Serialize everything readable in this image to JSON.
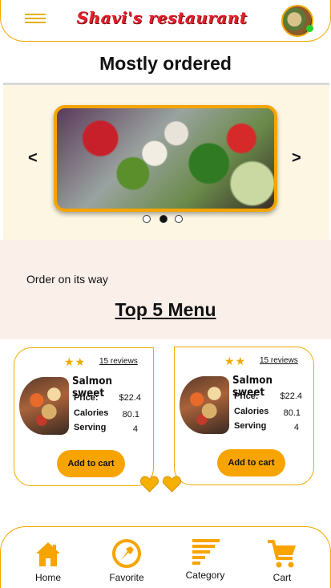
{
  "header": {
    "app_title": "Shavi's restaurant",
    "menu_icon": "hamburger-menu-icon",
    "avatar_icon": "profile-avatar",
    "status_color": "#23d12e"
  },
  "featured": {
    "title": "Mostly ordered",
    "prev_label": "<",
    "next_label": ">",
    "slide_count": 3,
    "active_slide": 2
  },
  "order_status": "Order on its way",
  "menu_section": {
    "heading": "Top 5 Menu",
    "cards": [
      {
        "stars": "★★",
        "reviews": "15 reviews",
        "name": "Salmon sweet",
        "price_label": "Price:",
        "price": "$22.4",
        "calories_label": "Calories",
        "calories": "80.1",
        "serving_label": "Serving",
        "serving": "4",
        "button": "Add to cart"
      },
      {
        "stars": "★★",
        "reviews": "15 reviews",
        "name": "Salmon sweet",
        "price_label": "Price:",
        "price": "$22.4",
        "calories_label": "Calories",
        "calories": "80.1",
        "serving_label": "Serving",
        "serving": "4",
        "button": "Add to cart"
      }
    ]
  },
  "bottom_nav": {
    "items": [
      {
        "label": "Home",
        "icon": "home-icon"
      },
      {
        "label": "Favorite",
        "icon": "favorite-badge-icon"
      },
      {
        "label": "Category",
        "icon": "category-bars-icon"
      },
      {
        "label": "Cart",
        "icon": "cart-icon"
      }
    ]
  },
  "colors": {
    "accent": "#f7a400",
    "brand_text": "#e8202a",
    "carousel_bg": "#fdf6e3",
    "status_bg": "#fbefea"
  }
}
